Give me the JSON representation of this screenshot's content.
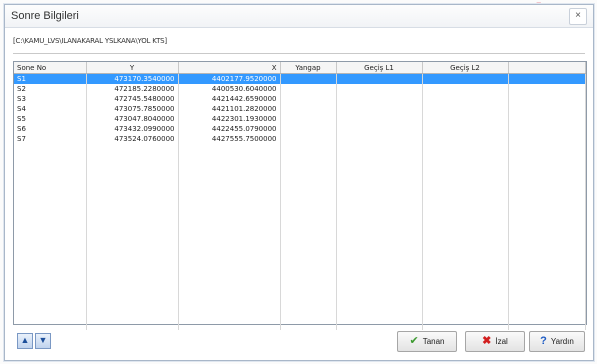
{
  "window": {
    "title": "Sonre Bilgileri",
    "close": "×"
  },
  "path": "[C:\\KAMU_LVS\\ILANAKARAL YSLKANA\\YOL KTS]",
  "table": {
    "headers": [
      "Sone No",
      "Y",
      "X",
      "Yangap",
      "Geçiş L1",
      "Geçiş L2",
      ""
    ],
    "rows": [
      [
        "S1",
        "473170.3540000",
        "4402177.9520000",
        "",
        "",
        "",
        ""
      ],
      [
        "S2",
        "472185.2280000",
        "4400530.6040000",
        "",
        "",
        "",
        ""
      ],
      [
        "S3",
        "472745.5480000",
        "4421442.6590000",
        "",
        "",
        "",
        ""
      ],
      [
        "S4",
        "473075.7850000",
        "4421101.2820000",
        "",
        "",
        "",
        ""
      ],
      [
        "S5",
        "473047.8040000",
        "4422301.1930000",
        "",
        "",
        "",
        ""
      ],
      [
        "S6",
        "473432.0990000",
        "4422455.0790000",
        "",
        "",
        "",
        ""
      ],
      [
        "S7",
        "473524.0760000",
        "4427555.7500000",
        "",
        "",
        "",
        ""
      ]
    ],
    "selected_row": 0
  },
  "buttons": {
    "up": "▲",
    "down": "▼",
    "ok_label": "Tanan",
    "cancel_label": "İzal",
    "help_label": "Yardın"
  },
  "colors": {
    "selection": "#3399ff"
  }
}
